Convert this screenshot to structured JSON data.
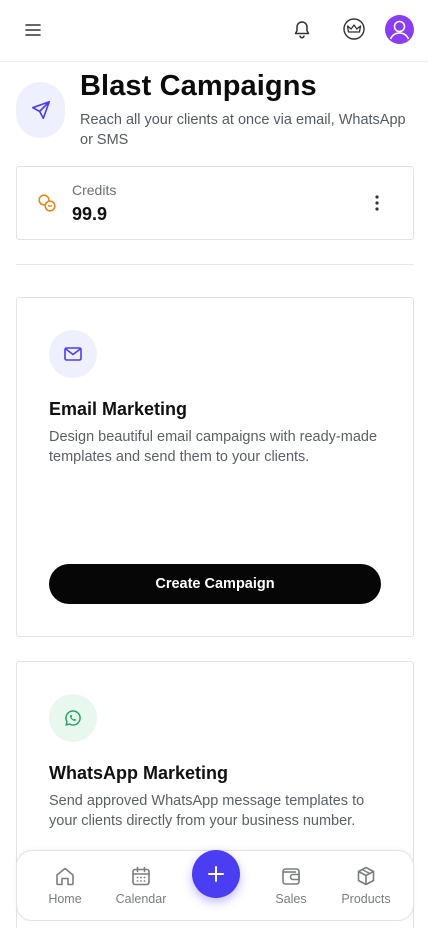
{
  "topbar": {
    "menu_icon": "hamburger-menu-icon",
    "bell_icon": "bell-icon",
    "crown_icon": "crown-icon",
    "avatar_icon": "user-icon",
    "avatar_color": "#8b3df5"
  },
  "header": {
    "title": "Blast Campaigns",
    "subtitle": "Reach all your clients at once via email, WhatsApp or SMS",
    "icon": "send-icon"
  },
  "credits": {
    "label": "Credits",
    "value": "99.9",
    "icon": "coins-icon",
    "accent": "#e08a1e"
  },
  "campaigns": [
    {
      "title": "Email Marketing",
      "description": "Design beautiful email campaigns with ready-made templates and send them to your clients.",
      "button": "Create Campaign",
      "icon": "mail-icon"
    },
    {
      "title": "WhatsApp Marketing",
      "description": "Send approved WhatsApp message templates to your clients directly from your business number.",
      "icon": "whatsapp-icon"
    }
  ],
  "bottom_nav": {
    "items": [
      {
        "label": "Home",
        "icon": "home-icon"
      },
      {
        "label": "Calendar",
        "icon": "calendar-icon"
      },
      {
        "label": "Sales",
        "icon": "wallet-icon"
      },
      {
        "label": "Products",
        "icon": "box-icon"
      }
    ],
    "fab_icon": "plus-icon",
    "fab_color": "#4b3df2"
  },
  "colors": {
    "primary": "#4b3df2",
    "button_bg": "#060606",
    "whatsapp_green": "#25a35a"
  }
}
